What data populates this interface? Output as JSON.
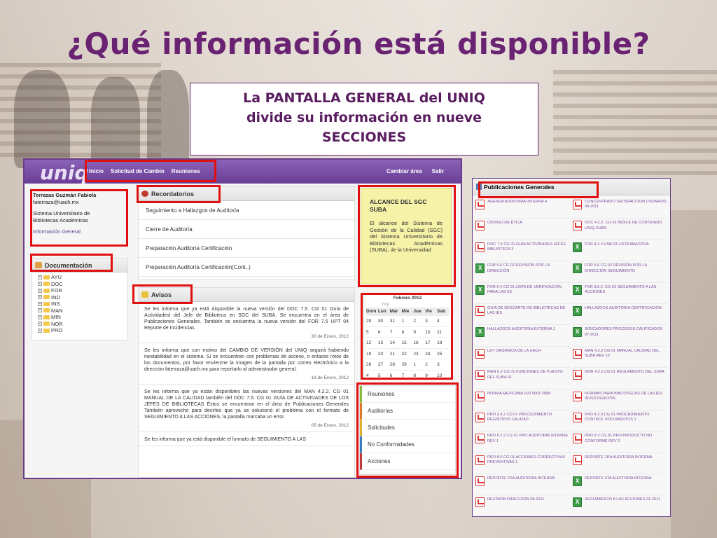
{
  "slide": {
    "title": "¿Qué información está disponible?",
    "callout_lines": [
      "La PANTALLA GENERAL del UNIQ",
      "divide su información en nueve",
      "SECCIONES"
    ]
  },
  "uniq": {
    "logo": "uniq",
    "nav": [
      "Inicio",
      "Solicitud de Cambio",
      "Reuniones"
    ],
    "nav_right": [
      "Cambiar área",
      "Salir"
    ],
    "user": {
      "name": "Terrazas Guzmán Fabiola",
      "email": "faterraza@uach.mx",
      "org_line1": "Sistema Universitario de",
      "org_line2": "Bibliotecas Académicas",
      "link": "Información General"
    },
    "documentacion": {
      "title": "Documentación",
      "folders": [
        "AYU",
        "DOC",
        "FOR",
        "IND",
        "INS",
        "MAN",
        "MIN",
        "NOR",
        "PRO"
      ]
    },
    "recordatorios": {
      "title": "Recordatorios",
      "items": [
        "Seguimiento a Hallazgos de Auditoría",
        "Cierre de Auditoría",
        "Preparación Auditoría Certificación",
        "Preparación Auditoría Certificación(Cont..)"
      ]
    },
    "avisos": {
      "title": "Avisos",
      "items": [
        {
          "text": "Se les informa que ya está disponible la nueva versión del DOC 7.5. CG 01 Guía de Actividadesl del Jefe de Biblioteca en SGC del SUBA. Se encuentra en el área de Publicaciones Generales. También se encuentra la nueva versión del FOR 7.5 UPT 04 Reporte de Incidencias.",
          "date": "30 de Enero, 2012"
        },
        {
          "text": "Se les informa que con motivo del CAMBIO DE VERSIÓN del UNIQ seguirá habiendo inestabilidad en el sistema. Si se encuentran con problemas de acceso, o enlaces rotos de los documentos, por favor envíenme la imagen de la pantalla por correo electrónico a la dirección faterraza@uach.mx para reportarlo al administrador general.",
          "date": "18 de Enero, 2012"
        },
        {
          "text": "Se les informa que ya están disponibles las nuevas versiones del MAN 4.2.2. CG 01 MANUAL DE LA CALIDAD también del DOC 7.5. CG 01 GUÍA DE ACTIVIDADES DE LOS JEFES DE BIBLIOTECAS Éstos se encuentran en el área de Publicaciones Generales También aprovecho para decirles que ya se solucionó el problema con el formato de SEGUIMIENTO A LAS ACCIONES, la pantalla marcaba un error.",
          "date": "05 de Enero, 2012"
        },
        {
          "text": "Se les informa que ya está disponible el formato de SEGUIMIENTO A LAS",
          "date": ""
        }
      ]
    },
    "alcance": {
      "title": "ALCANCE DEL SGC SUBA",
      "body": "El alcance del Sistema de Gestión de la Calidad (SGC) del Sistema Universitario de Bibliotecas Académicas (SUBA), de la Universidad"
    },
    "calendar": {
      "month": "Febrero 2012",
      "hoy": "hoy",
      "headers": [
        "Dom",
        "Lun",
        "Mar",
        "Mie",
        "Jue",
        "Vie",
        "Sab"
      ],
      "days": [
        "29",
        "30",
        "31",
        "1",
        "2",
        "3",
        "4",
        "5",
        "6",
        "7",
        "8",
        "9",
        "10",
        "11",
        "12",
        "13",
        "14",
        "15",
        "16",
        "17",
        "18",
        "19",
        "20",
        "21",
        "22",
        "23",
        "24",
        "25",
        "26",
        "27",
        "28",
        "29",
        "1",
        "2",
        "3",
        "4",
        "5",
        "6",
        "7",
        "8",
        "9",
        "10"
      ]
    },
    "side_menu": [
      "Reuniones",
      "Auditorías",
      "Solicitudes",
      "No Conformidades",
      "Acciones"
    ]
  },
  "publicaciones": {
    "title": "Publicaciones Generales",
    "items": [
      {
        "type": "pdf",
        "text": "Agenda auditoria interna 4"
      },
      {
        "type": "pdf",
        "text": "Concentrado satisfaccion usuarios 04-2011"
      },
      {
        "type": "pdf",
        "text": "Código de ética"
      },
      {
        "type": "pdf",
        "text": "DOC 4.2.2. CG 01 Índice de contenido UNIQ-SUBA"
      },
      {
        "type": "pdf",
        "text": "DOC 7.5 CG 01 Guía actividades jefes biblioteca 3"
      },
      {
        "type": "xls",
        "text": "FOR 4.2.3 USB 03 Lista maestra"
      },
      {
        "type": "xls",
        "text": "FOR 5.6 CG 02 Revisión por la dirección"
      },
      {
        "type": "xls",
        "text": "FOR 5.6 CG 02 Revisión por la dirección seguimiento"
      },
      {
        "type": "xls",
        "text": "FOR 6.4 CG 01 Lista de verificación para las 5S"
      },
      {
        "type": "xls",
        "text": "FOR 8.5.2. CG 02 Seguimiento a las acciones"
      },
      {
        "type": "pdf",
        "text": "Guia de descarte de bibliotecas de las IES"
      },
      {
        "type": "xls",
        "text": "Hallazgos auditoria certificacion"
      },
      {
        "type": "xls",
        "text": "Hallazgos auditoría externa 1"
      },
      {
        "type": "xls",
        "text": "Indicadores procesos calificados 07-2011"
      },
      {
        "type": "pdf",
        "text": "Ley orgánica de la UACH"
      },
      {
        "type": "pdf",
        "text": "MAN 4.2.2 CG 01 Manual calidad del SUBA rev 10"
      },
      {
        "type": "pdf",
        "text": "MAN 6.2 CG 01 Funciones de puesto del SUBA 01"
      },
      {
        "type": "pdf",
        "text": "NOR 4.2.2 CG 01 Reglamento del SUBA"
      },
      {
        "type": "pdf",
        "text": "Norma mexicana ISO 9001:2008"
      },
      {
        "type": "pdf",
        "text": "Normas para bibliotecas de las IES investigación"
      },
      {
        "type": "pdf",
        "text": "PRO 2.4.2 CD 01 Procedimiento registros calidad"
      },
      {
        "type": "pdf",
        "text": "PRO 4.2.3 CG 01 Procedimiento control documentos 1"
      },
      {
        "type": "pdf",
        "text": "PRO 8.2.2 CG 01 Pro auditoría interna rev 1"
      },
      {
        "type": "pdf",
        "text": "PRO 8.3 CG 01 Pro producto no conforme rev 2"
      },
      {
        "type": "pdf",
        "text": "PRO 8.5 CG 01 Acciones correctivas preventivas 1"
      },
      {
        "type": "pdf",
        "text": "Reporte 1ra auditoría interna"
      },
      {
        "type": "pdf",
        "text": "Reporte 2da auditoría interna"
      },
      {
        "type": "xls",
        "text": "Reporte 4ta auditoría interna"
      },
      {
        "type": "pdf",
        "text": "Revision direccion 08-2011"
      },
      {
        "type": "xls",
        "text": "Seguimiento a las acciones 01-2011"
      }
    ]
  },
  "colors": {
    "title": "#6a2272",
    "header": "#6a3d96",
    "highlight": "#e01010",
    "alcance_bg": "#f6f2a8"
  }
}
